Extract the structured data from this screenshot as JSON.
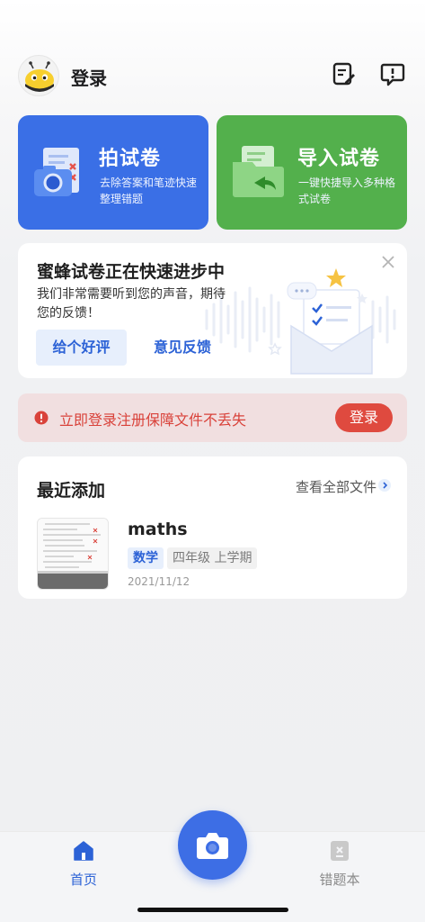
{
  "header": {
    "title": "登录",
    "avatar_icon": "bee-avatar-icon",
    "actions": [
      "edit-notes-icon",
      "feedback-icon"
    ]
  },
  "cards": [
    {
      "title": "拍试卷",
      "desc": "去除答案和笔迹快速整理错题",
      "color": "#3a6fe6",
      "icon": "camera-paper-icon"
    },
    {
      "title": "导入试卷",
      "desc": "一键快捷导入多种格式试卷",
      "color": "#53b04c",
      "icon": "import-folder-icon"
    }
  ],
  "promo": {
    "title": "蜜蜂试卷正在快速进步中",
    "text": "我们非常需要听到您的声音，期待您的反馈！",
    "rate_label": "给个好评",
    "feedback_label": "意见反馈"
  },
  "banner": {
    "text": "立即登录注册保障文件不丢失",
    "button_label": "登录",
    "color": "#df4a3f"
  },
  "recent": {
    "title": "最近添加",
    "view_all": "查看全部文件",
    "items": [
      {
        "name": "maths",
        "subject": "数学",
        "grade": "四年级 上学期",
        "date": "2021/11/12"
      }
    ]
  },
  "tabbar": {
    "home_label": "首页",
    "mistakes_label": "错题本",
    "accent": "#2c62d6"
  }
}
